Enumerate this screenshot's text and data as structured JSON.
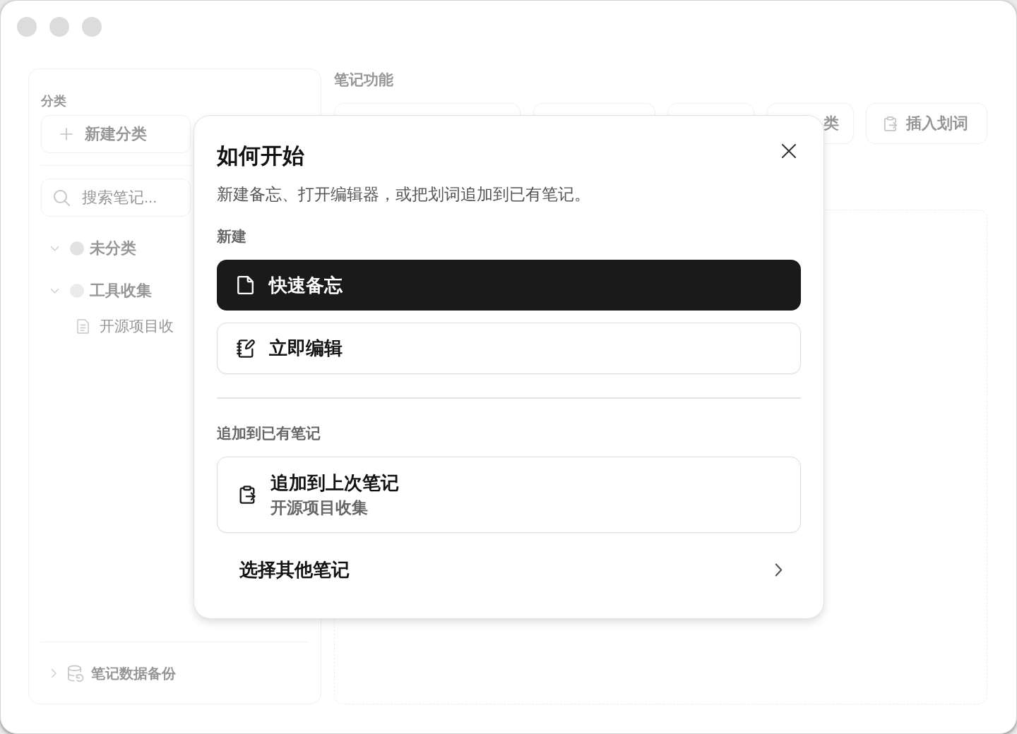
{
  "sidebar": {
    "section_label": "分类",
    "new_category_button": "新建分类",
    "search": {
      "placeholder": "搜索笔记..."
    },
    "tree": [
      {
        "label": "未分类",
        "expanded": true,
        "color": "#e2e2e2"
      },
      {
        "label": "工具收集",
        "expanded": true,
        "color": "#ebebeb",
        "children": [
          {
            "label": "开源项目收"
          }
        ]
      }
    ],
    "footer": {
      "label": "笔记数据备份",
      "expanded": false
    }
  },
  "main": {
    "title": "笔记功能",
    "toolbar": [
      {
        "kind": "covered"
      },
      {
        "kind": "covered"
      },
      {
        "kind": "covered"
      },
      {
        "kind": "text",
        "label": "类"
      },
      {
        "kind": "icon_text",
        "label": "插入划词"
      }
    ]
  },
  "dialog": {
    "title": "如何开始",
    "subtitle": "新建备忘、打开编辑器，或把划词追加到已有笔记。",
    "sections": [
      {
        "label": "新建",
        "actions": [
          {
            "kind": "primary",
            "label": "快速备忘"
          },
          {
            "kind": "outline",
            "label": "立即编辑"
          }
        ]
      },
      {
        "label": "追加到已有笔记",
        "actions": [
          {
            "kind": "card",
            "label": "追加到上次笔记",
            "detail": "开源项目收集"
          },
          {
            "kind": "link",
            "label": "选择其他笔记"
          }
        ]
      }
    ]
  }
}
